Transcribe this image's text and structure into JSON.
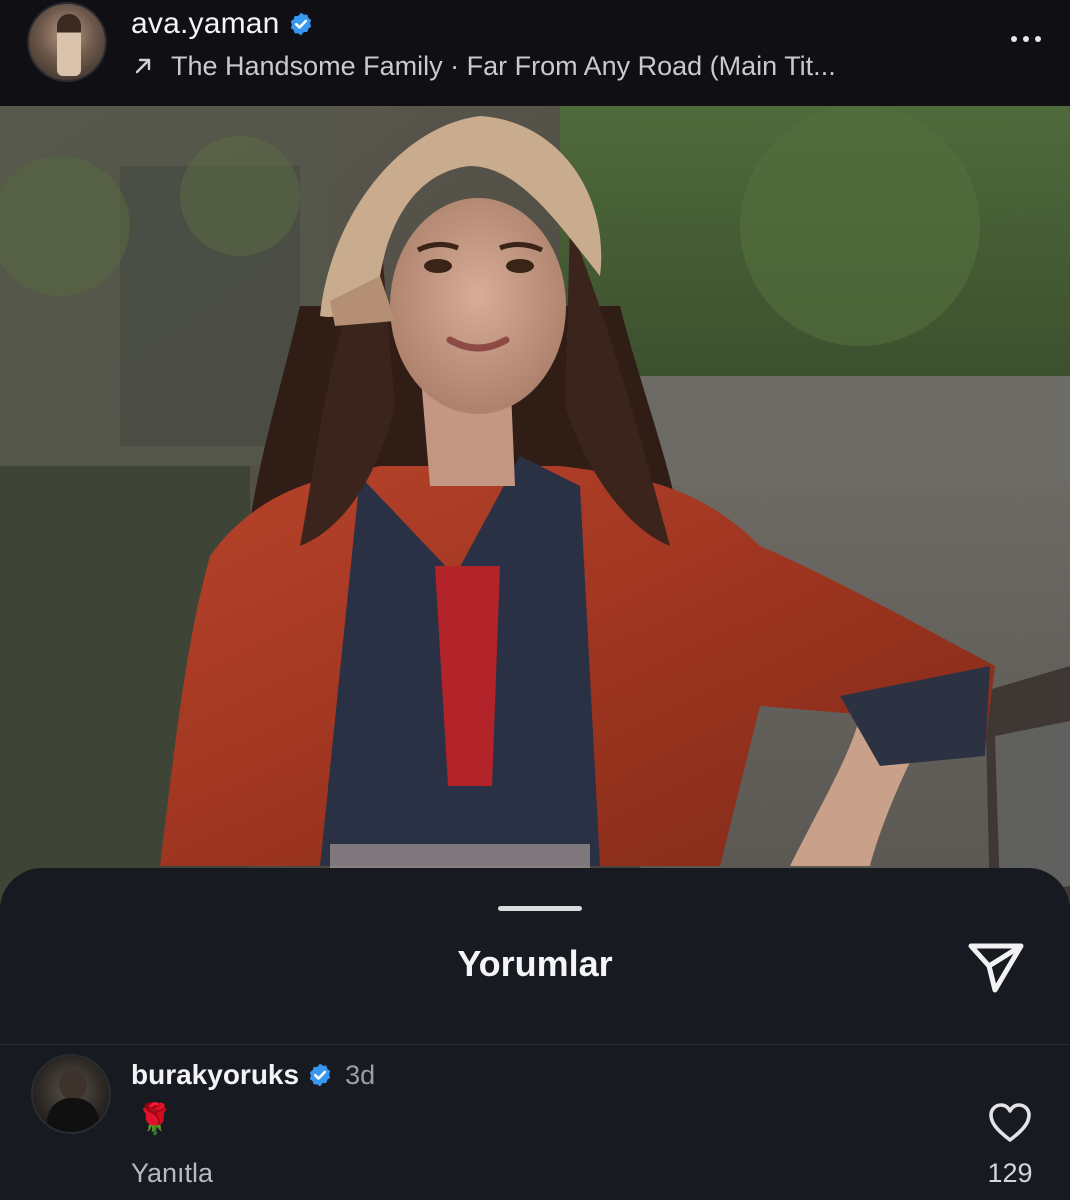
{
  "header": {
    "username": "ava.yaman",
    "music": "The Handsome Family · Far From Any Road (Main Tit..."
  },
  "comments_sheet": {
    "title": "Yorumlar"
  },
  "comments": [
    {
      "username": "burakyoruks",
      "time": "3d",
      "text": "🌹",
      "reply_label": "Yanıtla",
      "like_count": "129"
    }
  ],
  "icons": {
    "verified": "verified-badge-icon",
    "music": "arrow-up-right-icon",
    "more": "more-dots-icon",
    "send": "paper-plane-icon",
    "like": "heart-outline-icon"
  },
  "colors": {
    "verified_blue": "#3897f0",
    "sheet_background": "#181a21",
    "header_background": "#101014"
  }
}
